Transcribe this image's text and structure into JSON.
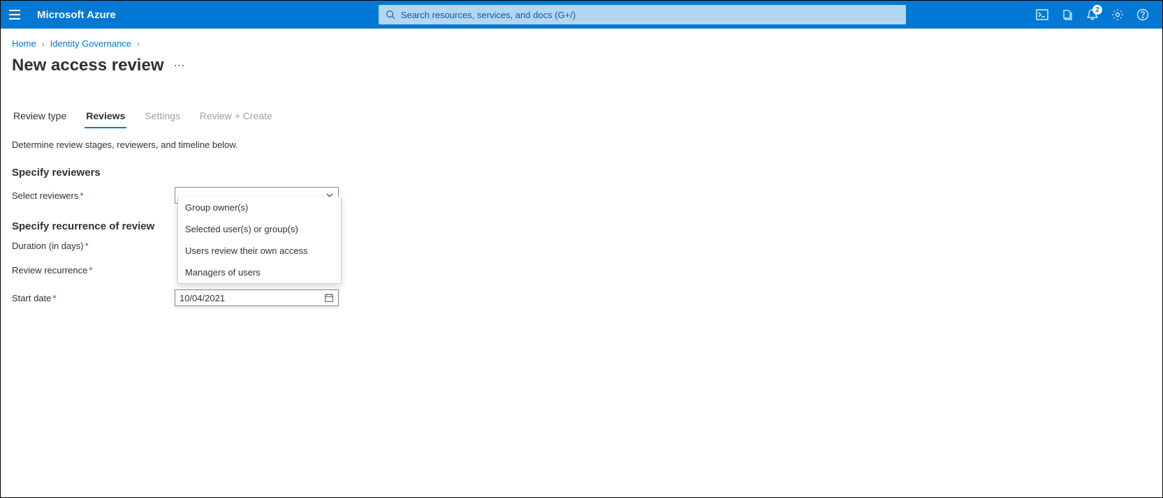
{
  "brand": "Microsoft Azure",
  "search": {
    "placeholder": "Search resources, services, and docs (G+/)"
  },
  "notifications": {
    "count": "2"
  },
  "breadcrumb": {
    "home": "Home",
    "identity": "Identity Governance"
  },
  "page": {
    "title": "New access review"
  },
  "tabs": {
    "review_type": "Review type",
    "reviews": "Reviews",
    "settings": "Settings",
    "review_create": "Review + Create"
  },
  "description": "Determine review stages, reviewers, and timeline below.",
  "sections": {
    "specify_reviewers": "Specify reviewers",
    "specify_recurrence": "Specify recurrence of review"
  },
  "labels": {
    "select_reviewers": "Select reviewers",
    "duration": "Duration (in days)",
    "recurrence": "Review recurrence",
    "start_date": "Start date"
  },
  "dropdown": {
    "options": {
      "group_owners": "Group owner(s)",
      "selected_users": "Selected user(s) or group(s)",
      "users_review_own": "Users review their own access",
      "managers": "Managers of users"
    }
  },
  "values": {
    "start_date": "10/04/2021"
  }
}
